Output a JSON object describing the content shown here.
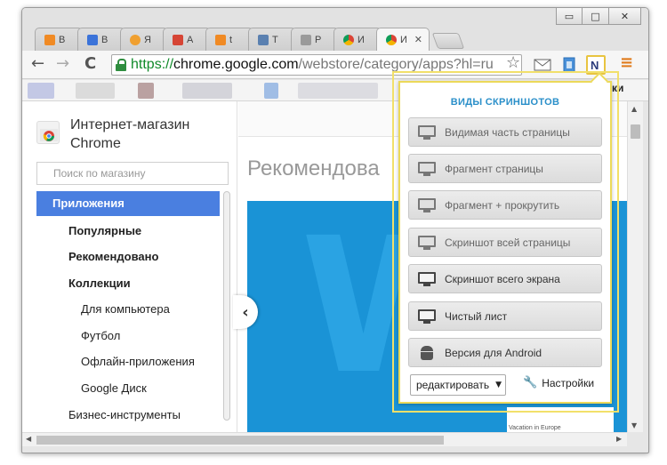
{
  "window_controls": {
    "minimize": "▭",
    "maximize": "□",
    "close": "✕"
  },
  "tabs": [
    {
      "label": "В",
      "color": "#f08a24",
      "active": false
    },
    {
      "label": "В",
      "color": "#3b73d9",
      "active": false
    },
    {
      "label": "Я",
      "color": "#f0a030",
      "active": false
    },
    {
      "label": "А",
      "color": "#d64535",
      "active": false
    },
    {
      "label": "t",
      "color": "#f08a24",
      "active": false
    },
    {
      "label": "Т",
      "color": "#5a80b0",
      "active": false
    },
    {
      "label": "Р",
      "color": "#9a9a9a",
      "active": false
    },
    {
      "label": "И",
      "color": "#4c8ff0",
      "active": false
    },
    {
      "label": "И",
      "color": "#4c8ff0",
      "active": true
    }
  ],
  "active_tab_close": "✕",
  "toolbar": {
    "back": "←",
    "forward": "→",
    "reload": "C",
    "url_scheme": "https://",
    "url_host": "chrome.google.com",
    "url_path": "/webstore/category/apps?hl=ru",
    "star": "☆",
    "menu": "≡"
  },
  "bookmarks_partial": "ки",
  "sidebar": {
    "store_title": "Интернет-магазин Chrome",
    "search_placeholder": "Поиск по магазину",
    "active_item": "Приложения",
    "items": [
      "Популярные",
      "Рекомендовано",
      "Коллекции"
    ],
    "sub_items": [
      "Для компьютера",
      "Футбол",
      "Офлайн-приложения",
      "Google Диск"
    ],
    "last_item": "Бизнес-инструменты"
  },
  "main": {
    "title": "Рекомендова",
    "banner_letter": "W",
    "banner_caption": "Vacation in Europe",
    "carousel_prev": "‹"
  },
  "popup": {
    "title": "ВИДЫ СКРИНШОТОВ",
    "buttons": [
      {
        "label": "Видимая часть страницы",
        "icon": "monitor-icon"
      },
      {
        "label": "Фрагмент страницы",
        "icon": "monitor-icon"
      },
      {
        "label": "Фрагмент + прокрутить",
        "icon": "monitor-icon"
      },
      {
        "label": "Скриншот всей страницы",
        "icon": "monitor-icon"
      },
      {
        "label": "Скриншот всего экрана",
        "icon": "monitor-icon"
      },
      {
        "label": "Чистый лист",
        "icon": "monitor-icon"
      },
      {
        "label": "Версия для Android",
        "icon": "android-icon"
      }
    ],
    "edit_select": "редактировать",
    "edit_caret": "▼",
    "settings": "Настройки"
  },
  "colors": {
    "accent_blue": "#4a7fe0",
    "popup_title": "#2a8fc9",
    "highlight_yellow": "#ecd95a",
    "banner_blue": "#1a93d6",
    "url_green": "#108a2a"
  }
}
